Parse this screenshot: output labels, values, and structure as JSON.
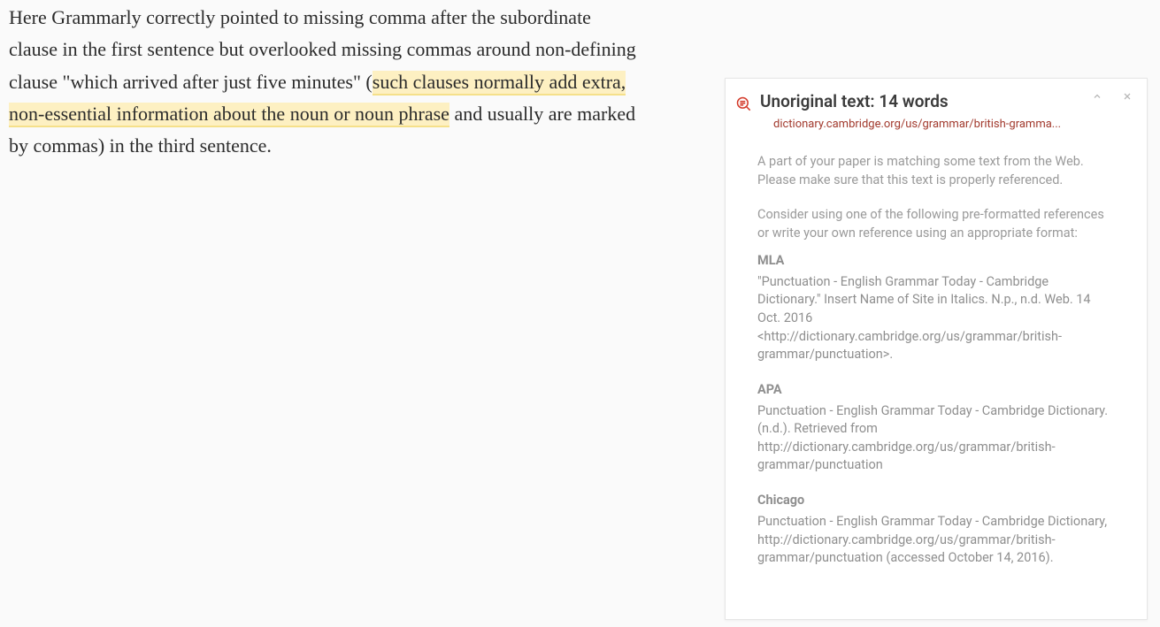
{
  "main": {
    "before_highlight": "Here Grammarly correctly pointed to missing comma after the subordinate clause in the first sentence but overlooked missing commas around non-defining clause \"which arrived after just five minutes\" (",
    "highlighted": "such clauses normally add extra, non-essential information about the noun or noun phrase",
    "after_highlight": " and usually are marked by commas) in the third sentence."
  },
  "card": {
    "title": "Unoriginal text: 14 words",
    "source": "dictionary.cambridge.org/us/grammar/british-gramma...",
    "para1": "A part of your paper is matching some text from the Web. Please make sure that this text is properly referenced.",
    "para2": "Consider using one of the following pre-formatted references or write your own reference using an appropriate format:",
    "refs": [
      {
        "label": "MLA",
        "text": "\"Punctuation - English Grammar Today - Cambridge Dictionary.\" Insert Name of Site in Italics. N.p., n.d. Web. 14 Oct. 2016 <http://dictionary.cambridge.org/us/grammar/british-grammar/punctuation>."
      },
      {
        "label": "APA",
        "text": "Punctuation - English Grammar Today - Cambridge Dictionary. (n.d.). Retrieved from http://dictionary.cambridge.org/us/grammar/british-grammar/punctuation"
      },
      {
        "label": "Chicago",
        "text": "Punctuation - English Grammar Today - Cambridge Dictionary, http://dictionary.cambridge.org/us/grammar/british-grammar/punctuation (accessed October 14, 2016)."
      }
    ]
  }
}
